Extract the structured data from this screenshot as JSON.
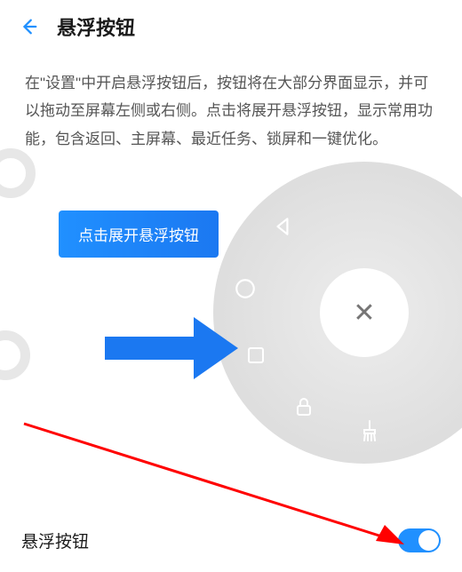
{
  "header": {
    "title": "悬浮按钮"
  },
  "description": "在\"设置\"中开启悬浮按钮后，按钮将在大部分界面显示，并可以拖动至屏幕左侧或右侧。点击将展开悬浮按钮，显示常用功能，包含返回、主屏幕、最近任务、锁屏和一键优化。",
  "bubble": {
    "text": "点击展开悬浮按钮"
  },
  "fan": {
    "center_symbol": "✕",
    "icons": [
      "back-triangle",
      "circle",
      "square",
      "lock",
      "brush"
    ]
  },
  "toggle": {
    "label": "悬浮按钮",
    "state": "on"
  },
  "colors": {
    "accent": "#2090ff",
    "arrow_annotation": "#ff0000"
  }
}
